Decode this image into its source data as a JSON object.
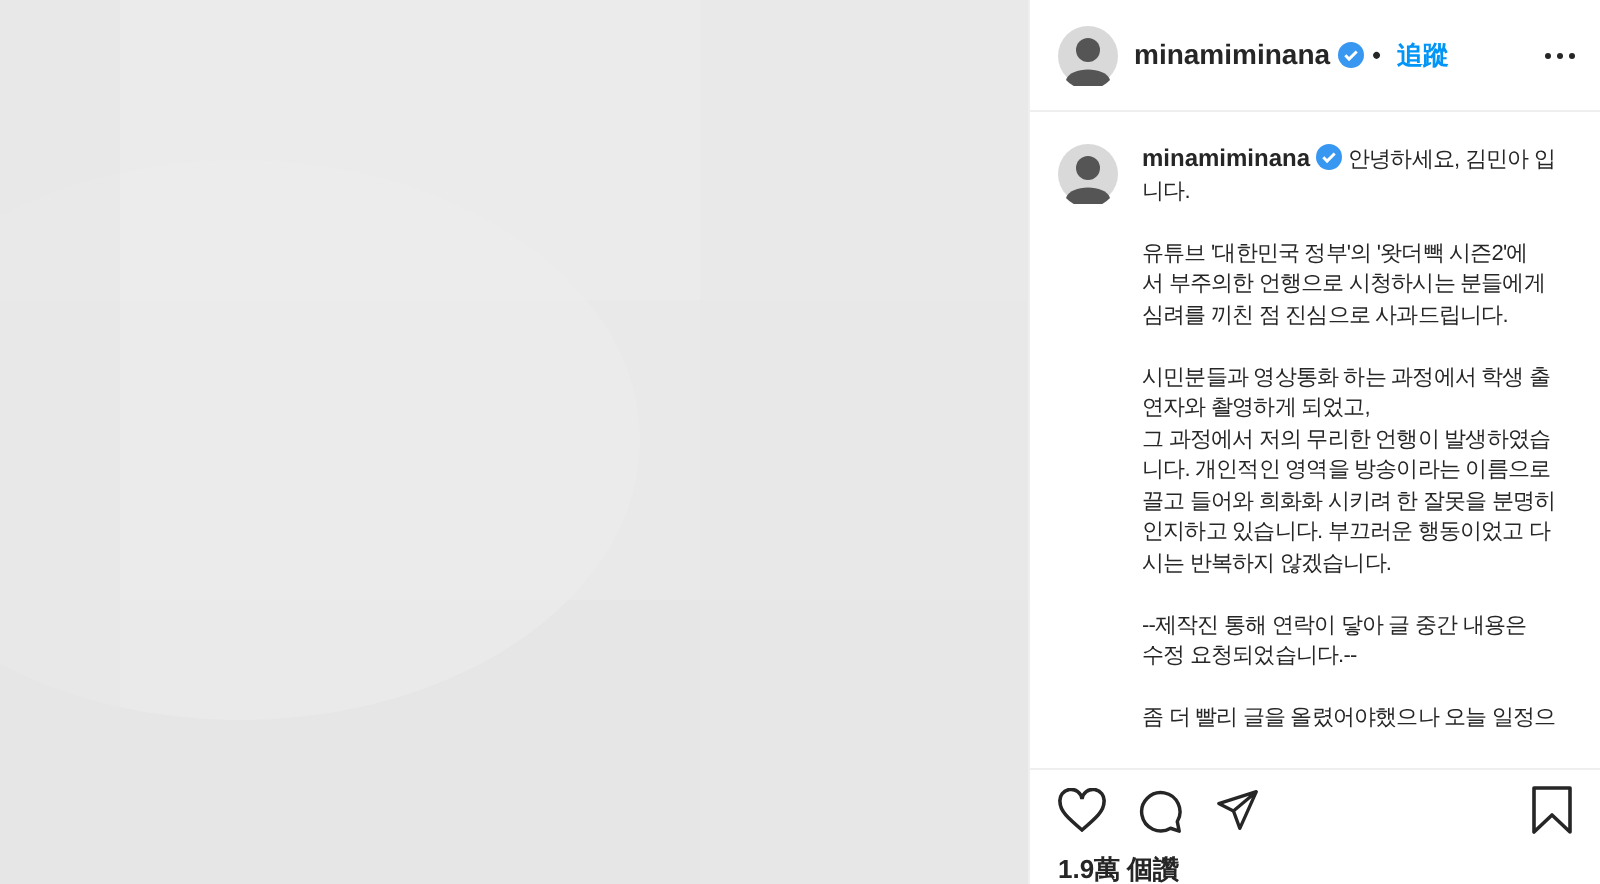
{
  "header": {
    "username": "minamiminana",
    "verified": true,
    "separator": "•",
    "follow": "追蹤"
  },
  "caption": {
    "username": "minamiminana",
    "verified": true,
    "paragraphs": [
      [
        "안녕하세요, 김민아 입",
        "니다."
      ],
      [
        "유튜브 '대한민국 정부'의 '왓더빽 시즌2'에",
        "서 부주의한 언행으로 시청하시는 분들에게",
        "심려를 끼친 점 진심으로 사과드립니다."
      ],
      [
        "시민분들과 영상통화 하는 과정에서 학생 출",
        "연자와 촬영하게 되었고,",
        "그 과정에서 저의 무리한 언행이 발생하였습",
        "니다. 개인적인 영역을 방송이라는 이름으로",
        "끌고 들어와 희화화 시키려 한 잘못을 분명히",
        "인지하고 있습니다. 부끄러운 행동이었고 다",
        "시는 반복하지 않겠습니다."
      ],
      [
        "--제작진 통해 연락이 닿아 글 중간 내용은",
        "수정 요청되었습니다.--"
      ],
      [
        "좀 더 빨리 글을 올렸어야했으나 오늘 일정으"
      ]
    ]
  },
  "actions": {
    "liked": false,
    "saved": false
  },
  "likes": "1.9萬 個讚"
}
